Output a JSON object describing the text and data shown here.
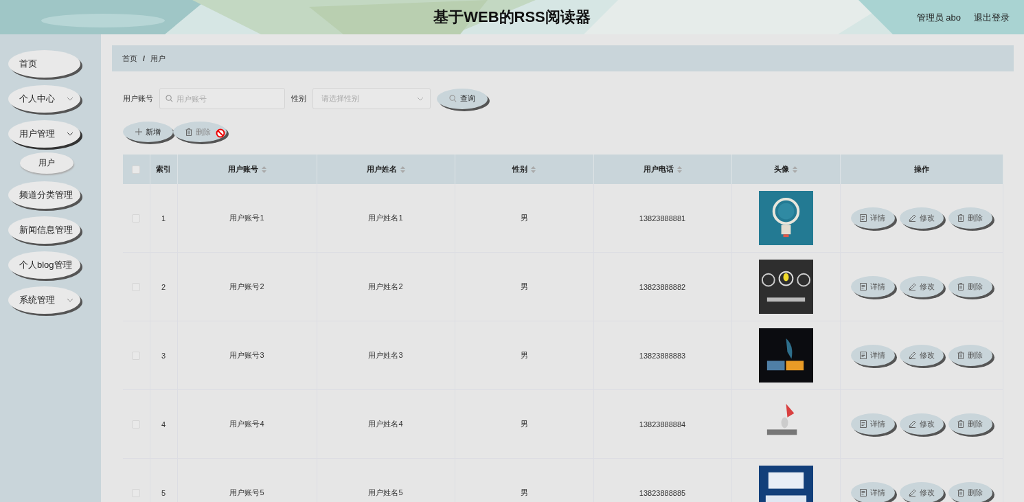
{
  "header": {
    "title": "基于WEB的RSS阅读器",
    "user": "管理员 abo",
    "logout": "退出登录"
  },
  "sidebar": {
    "items": [
      {
        "label": "首页",
        "kind": "link",
        "expanded": false
      },
      {
        "label": "个人中心",
        "kind": "submenu",
        "expanded": false
      },
      {
        "label": "用户管理",
        "kind": "submenu",
        "expanded": true,
        "children": [
          {
            "label": "用户"
          }
        ]
      },
      {
        "label": "频道分类管理",
        "kind": "link",
        "expanded": false
      },
      {
        "label": "新闻信息管理",
        "kind": "link",
        "expanded": false
      },
      {
        "label": "个人blog管理",
        "kind": "link",
        "expanded": false
      },
      {
        "label": "系统管理",
        "kind": "submenu",
        "expanded": false
      }
    ]
  },
  "breadcrumb": {
    "items": [
      "首页",
      "用户"
    ],
    "separator": "/"
  },
  "search": {
    "account_label": "用户账号",
    "account_placeholder": "用户账号",
    "gender_label": "性别",
    "gender_placeholder": "请选择性别",
    "query_button": "查询"
  },
  "toolbar": [
    {
      "label": "新增",
      "kind": "add",
      "disabled": false
    },
    {
      "label": "删除",
      "kind": "delete",
      "disabled": true
    }
  ],
  "table": {
    "select_all_checked": false,
    "columns": [
      {
        "label": "索引",
        "sortable": false
      },
      {
        "label": "用户账号",
        "sortable": true
      },
      {
        "label": "用户姓名",
        "sortable": true
      },
      {
        "label": "性别",
        "sortable": true
      },
      {
        "label": "用户电话",
        "sortable": true
      },
      {
        "label": "头像",
        "sortable": true
      },
      {
        "label": "操作",
        "sortable": false
      }
    ],
    "rows": [
      {
        "checked": false,
        "index": "1",
        "account": "用户账号1",
        "name": "用户姓名1",
        "gender": "男",
        "phone": "13823888881",
        "actions": [
          "详情",
          "修改",
          "删除"
        ]
      },
      {
        "checked": false,
        "index": "2",
        "account": "用户账号2",
        "name": "用户姓名2",
        "gender": "男",
        "phone": "13823888882",
        "actions": [
          "详情",
          "修改",
          "删除"
        ]
      },
      {
        "checked": false,
        "index": "3",
        "account": "用户账号3",
        "name": "用户姓名3",
        "gender": "男",
        "phone": "13823888883",
        "actions": [
          "详情",
          "修改",
          "删除"
        ]
      },
      {
        "checked": false,
        "index": "4",
        "account": "用户账号4",
        "name": "用户姓名4",
        "gender": "男",
        "phone": "13823888884",
        "actions": [
          "详情",
          "修改",
          "删除"
        ]
      },
      {
        "checked": false,
        "index": "5",
        "account": "用户账号5",
        "name": "用户姓名5",
        "gender": "男",
        "phone": "13823888885",
        "actions": [
          "详情",
          "修改",
          "删除"
        ]
      }
    ]
  }
}
